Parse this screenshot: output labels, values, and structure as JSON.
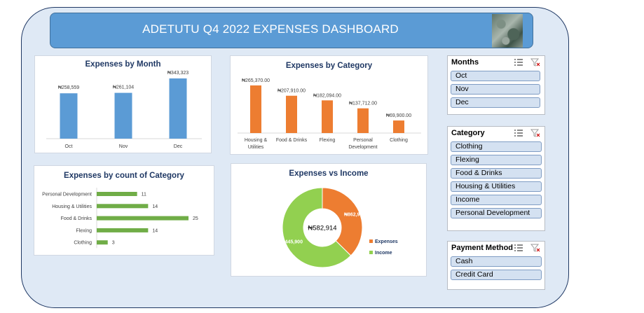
{
  "header": {
    "title": "ADETUTU Q4 2022 EXPENSES DASHBOARD"
  },
  "colors": {
    "blue": "#5b9bd5",
    "orange": "#ed7d31",
    "green": "#70ad47",
    "title": "#1f3864"
  },
  "charts": {
    "month": {
      "title": "Expenses by Month"
    },
    "category": {
      "title": "Expenses by Category"
    },
    "count": {
      "title": "Expenses by count of Category"
    },
    "income": {
      "title": "Expenses vs Income"
    }
  },
  "chart_data": [
    {
      "type": "bar",
      "title": "Expenses by Month",
      "categories": [
        "Oct",
        "Nov",
        "Dec"
      ],
      "values": [
        258559,
        261104,
        343323
      ],
      "labels": [
        "₦258,559",
        "₦261,104",
        "₦343,323"
      ],
      "ylim": [
        0,
        343323
      ],
      "grid": false,
      "color": "#5b9bd5"
    },
    {
      "type": "bar",
      "title": "Expenses by Category",
      "categories": [
        "Housing & Utilities",
        "Food & Drinks",
        "Flexing",
        "Personal Development",
        "Clothing"
      ],
      "category_lines": [
        [
          "Housing &",
          "Utilities"
        ],
        [
          "Food & Drinks"
        ],
        [
          "Flexing"
        ],
        [
          "Personal",
          "Development"
        ],
        [
          "Clothing"
        ]
      ],
      "values": [
        265370.0,
        207910.0,
        182094.0,
        137712.0,
        69900.0
      ],
      "labels": [
        "₦265,370.00",
        "₦207,910.00",
        "₦182,094.00",
        "₦137,712.00",
        "₦69,900.00"
      ],
      "ylim": [
        0,
        265370
      ],
      "grid": false,
      "color": "#ed7d31"
    },
    {
      "type": "bar",
      "orientation": "horizontal",
      "title": "Expenses by count of Category",
      "categories": [
        "Personal Development",
        "Housing & Utilities",
        "Food & Drinks",
        "Flexing",
        "Clothing"
      ],
      "values": [
        11,
        14,
        25,
        14,
        3
      ],
      "xlim": [
        0,
        25
      ],
      "grid": false,
      "color": "#70ad47"
    },
    {
      "type": "pie",
      "donut": true,
      "title": "Expenses vs Income",
      "categories": [
        "Expenses",
        "Income"
      ],
      "values": [
        862986,
        1445900
      ],
      "labels": [
        "₦862,986",
        "₦1,445,900"
      ],
      "center_label": "₦582,914",
      "colors": [
        "#ed7d31",
        "#92d050"
      ],
      "legend": "right"
    }
  ],
  "slicers": {
    "months": {
      "header": "Months",
      "items": [
        "Oct",
        "Nov",
        "Dec"
      ]
    },
    "category": {
      "header": "Category",
      "items": [
        "Clothing",
        "Flexing",
        "Food & Drinks",
        "Housing & Utilities",
        "Income",
        "Personal Development"
      ]
    },
    "payment": {
      "header": "Payment Method",
      "items": [
        "Cash",
        "Credit Card"
      ]
    }
  }
}
